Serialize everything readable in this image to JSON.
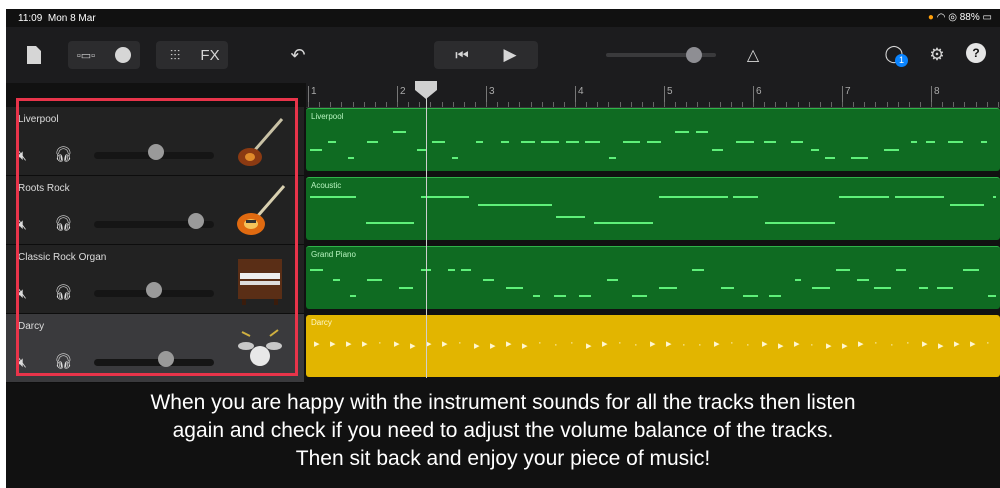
{
  "status": {
    "time": "11:09",
    "date": "Mon 8 Mar",
    "battery": "88%"
  },
  "toolbar": {
    "fx_label": "FX",
    "help_label": "?",
    "notification_badge": "1",
    "master_volume": 0.8
  },
  "ruler": {
    "bars": [
      "1",
      "2",
      "3",
      "4",
      "5",
      "6",
      "7",
      "8"
    ]
  },
  "tracks": [
    {
      "name": "Liverpool",
      "region": "Liverpool",
      "volume": 0.52,
      "instrument": "bass-guitar-icon"
    },
    {
      "name": "Roots Rock",
      "region": "Acoustic",
      "volume": 0.85,
      "instrument": "electric-guitar-icon"
    },
    {
      "name": "Classic Rock Organ",
      "region": "Grand Piano",
      "volume": 0.5,
      "instrument": "organ-icon"
    },
    {
      "name": "Darcy",
      "region": "Darcy",
      "volume": 0.6,
      "instrument": "drum-kit-icon"
    }
  ],
  "caption": {
    "line1": "When you are happy with the instrument sounds for all the tracks then listen",
    "line2": "again and check if you need to adjust the volume balance of the tracks.",
    "line3": "Then sit back and enjoy your piece of music!"
  },
  "colors": {
    "highlight": "#e8344a",
    "region_green": "#0f6b22",
    "region_yellow": "#e2b500",
    "badge": "#0a84ff"
  }
}
